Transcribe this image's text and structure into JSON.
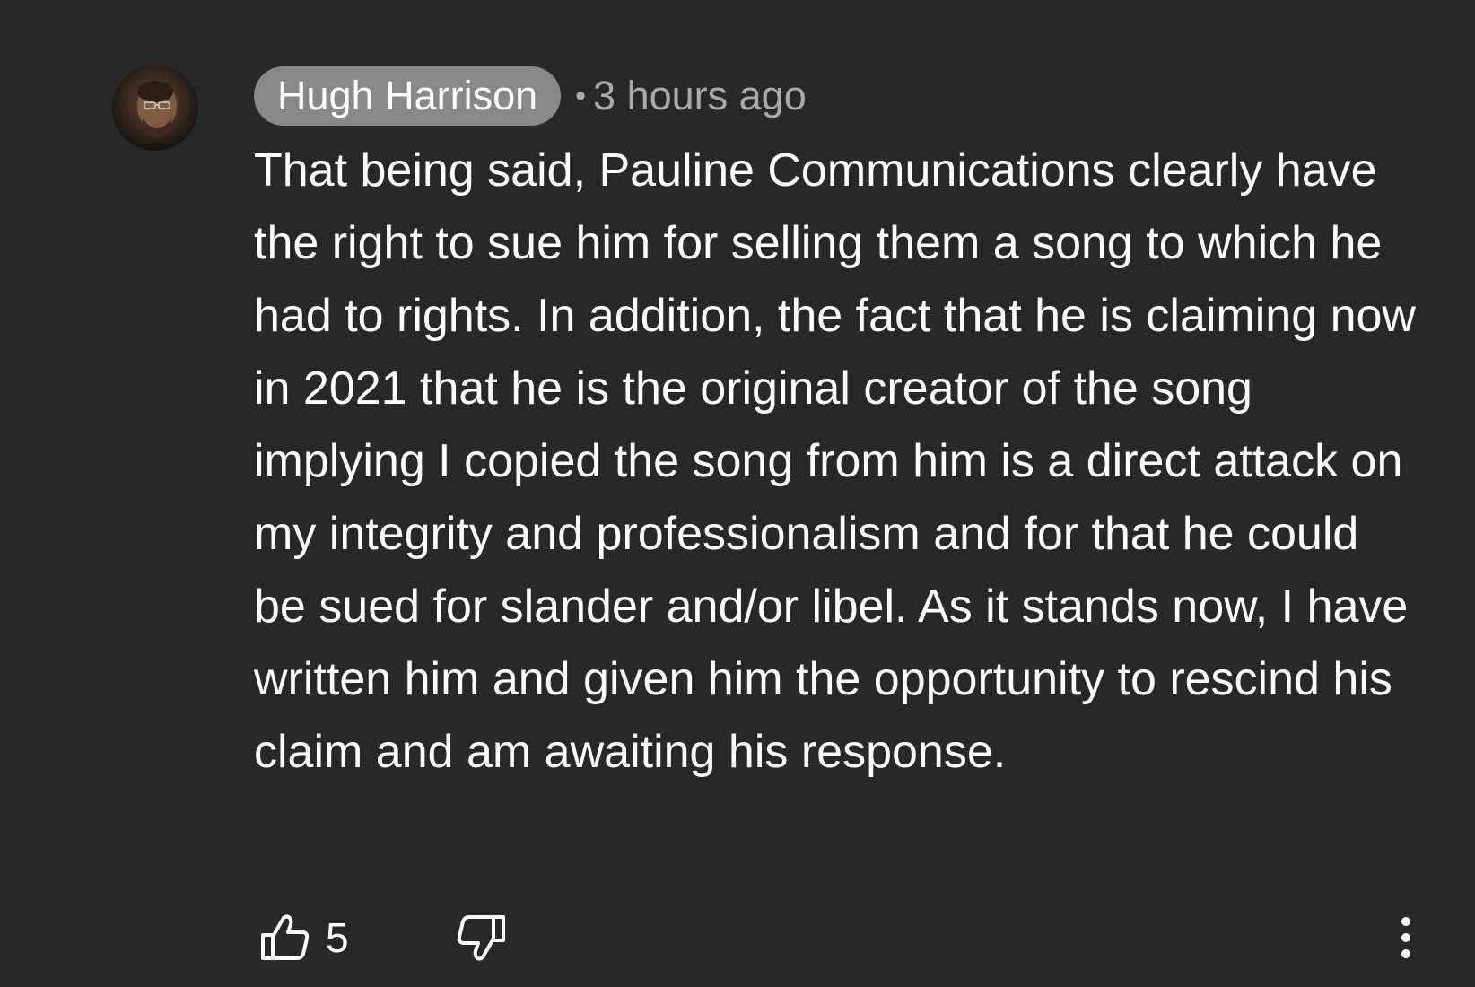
{
  "comment": {
    "author": "Hugh Harrison",
    "separator": "•",
    "timestamp": "3 hours ago",
    "text": "That being said, Pauline Communications clearly have the right to sue him for selling them a song to which he had to rights. In addition, the fact that he is claiming now in 2021 that he is the original creator of the song implying I copied the song from him is a direct attack on my integrity and professionalism and for that he could be sued for slander and/or libel. As it stands now, I have written him and given him the opportunity to rescind his claim and am awaiting his response.",
    "like_count": "5"
  },
  "icons": {
    "avatar": "user-avatar",
    "like": "thumbs-up-icon",
    "dislike": "thumbs-down-icon",
    "more": "more-vertical-icon"
  },
  "colors": {
    "background": "#282828",
    "author_chip": "#888888",
    "secondary_text": "#aaaaaa",
    "primary_text": "#ffffff"
  }
}
